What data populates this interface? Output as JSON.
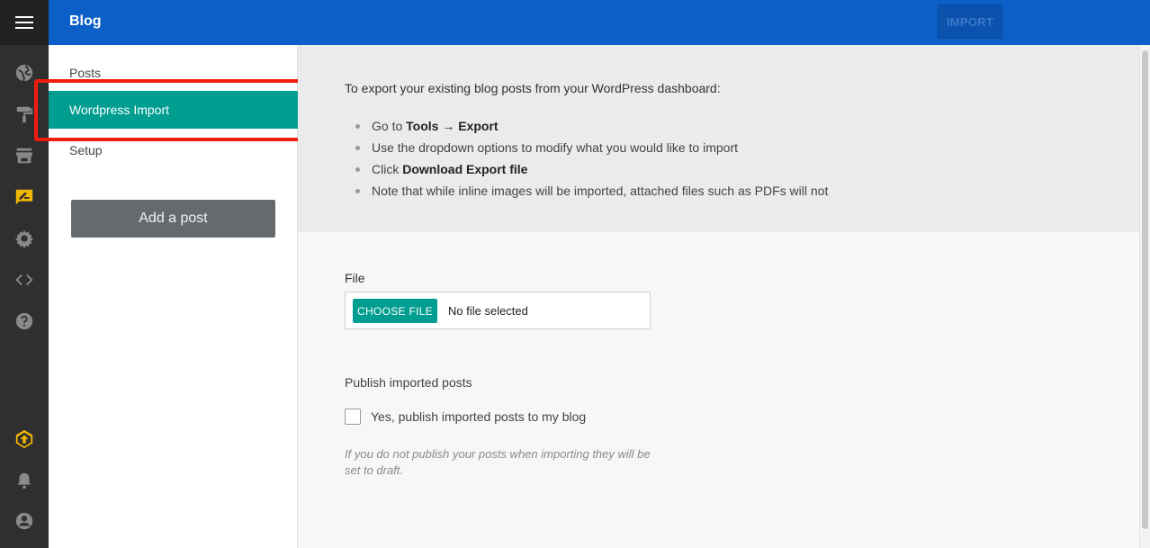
{
  "topbar": {
    "title": "Blog",
    "import_label": "IMPORT"
  },
  "rail": {
    "icons": [
      "menu-icon",
      "globe-icon",
      "paint-roller-icon",
      "store-icon",
      "blog-edit-icon",
      "gear-icon",
      "code-icon",
      "help-icon",
      "upgrade-icon",
      "bell-icon",
      "account-icon"
    ],
    "active_icon": "blog-edit-icon",
    "accent": "#f2b600"
  },
  "subnav": {
    "items": [
      {
        "label": "Posts"
      },
      {
        "label": "Wordpress Import"
      },
      {
        "label": "Setup"
      }
    ],
    "active_index": 1,
    "add_post_label": "Add a post"
  },
  "main": {
    "intro": "To export your existing blog posts from your WordPress dashboard:",
    "steps": [
      {
        "pre": "Go to ",
        "bold": "Tools → Export",
        "post": ""
      },
      {
        "pre": "Use the dropdown options to modify what you would like to import",
        "bold": "",
        "post": ""
      },
      {
        "pre": "Click ",
        "bold": "Download Export file",
        "post": ""
      },
      {
        "pre": "Note that while inline images will be imported, attached files such as PDFs will not",
        "bold": "",
        "post": ""
      }
    ],
    "file_label": "File",
    "choose_file_label": "CHOOSE FILE",
    "no_file_text": "No file selected",
    "publish_label": "Publish imported posts",
    "publish_checkbox_label": "Yes, publish imported posts to my blog",
    "publish_checked": false,
    "hint": "If you do not publish your posts when importing they will be set to draft."
  },
  "colors": {
    "topbar": "#0b5fc6",
    "teal": "#009e90",
    "highlight": "#f21c0e",
    "rail": "#2f2f2f"
  }
}
